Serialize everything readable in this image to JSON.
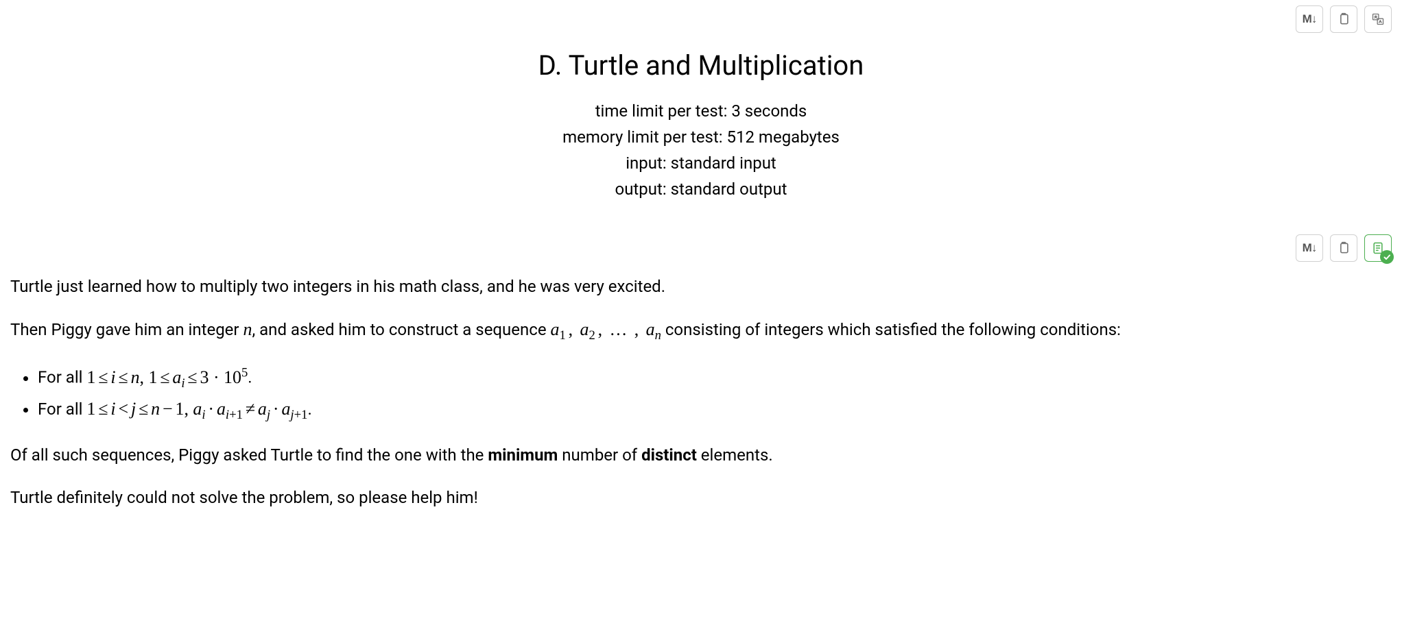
{
  "title": "D. Turtle and Multiplication",
  "meta": {
    "time_limit": "time limit per test: 3 seconds",
    "memory_limit": "memory limit per test: 512 megabytes",
    "input": "input: standard input",
    "output": "output: standard output"
  },
  "toolbar": {
    "markdown_label": "M↓",
    "copy_label": "Copy",
    "ai_label": "AI"
  },
  "body": {
    "p1": "Turtle just learned how to multiply two integers in his math class, and he was very excited.",
    "p2_a": "Then Piggy gave him an integer ",
    "p2_b": ", and asked him to construct a sequence ",
    "p2_c": " consisting of integers which satisfied the following conditions:",
    "li1_a": "For all ",
    "li1_b": ".",
    "li2_a": "For all ",
    "li2_b": ".",
    "p3_a": "Of all such sequences, Piggy asked Turtle to find the one with the ",
    "p3_b": "minimum",
    "p3_c": " number of ",
    "p3_d": "distinct",
    "p3_e": " elements.",
    "p4": "Turtle definitely could not solve the problem, so please help him!"
  },
  "math": {
    "n": "n",
    "seq": "a₁, a₂, …, aₙ",
    "cond1": "1 ≤ i ≤ n, 1 ≤ aᵢ ≤ 3·10⁵",
    "cond2": "1 ≤ i < j ≤ n − 1, aᵢ · aᵢ₊₁ ≠ aⱼ · aⱼ₊₁"
  }
}
